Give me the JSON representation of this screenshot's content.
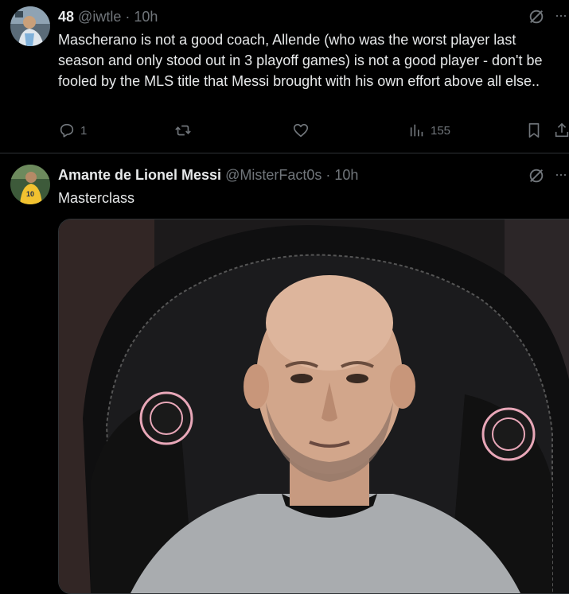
{
  "tweets": [
    {
      "name": "48",
      "handle": "@iwtle",
      "dot": "·",
      "time": "10h",
      "text": "Mascherano is not a good coach, Allende (who was the worst player last season and only stood out in 3 playoff games) is not a good player - don't be fooled by the MLS title that Messi brought with his own effort above all else..",
      "actions": {
        "reply_count": "1",
        "retweet_count": "",
        "like_count": "",
        "views_count": "155"
      },
      "top_icon": "grok-icon",
      "more_label": "···"
    },
    {
      "name": "Amante de Lionel Messi",
      "handle": "@MisterFact0s",
      "dot": "·",
      "time": "10h",
      "text": "Masterclass",
      "top_icon": "grok-icon",
      "more_label": "···",
      "media": {
        "kind": "photo",
        "description_icon": "photo-icon"
      }
    }
  ],
  "colors": {
    "background": "#000000",
    "text_primary": "#e7e9ea",
    "text_secondary": "#71767b",
    "divider": "#2f3336"
  }
}
